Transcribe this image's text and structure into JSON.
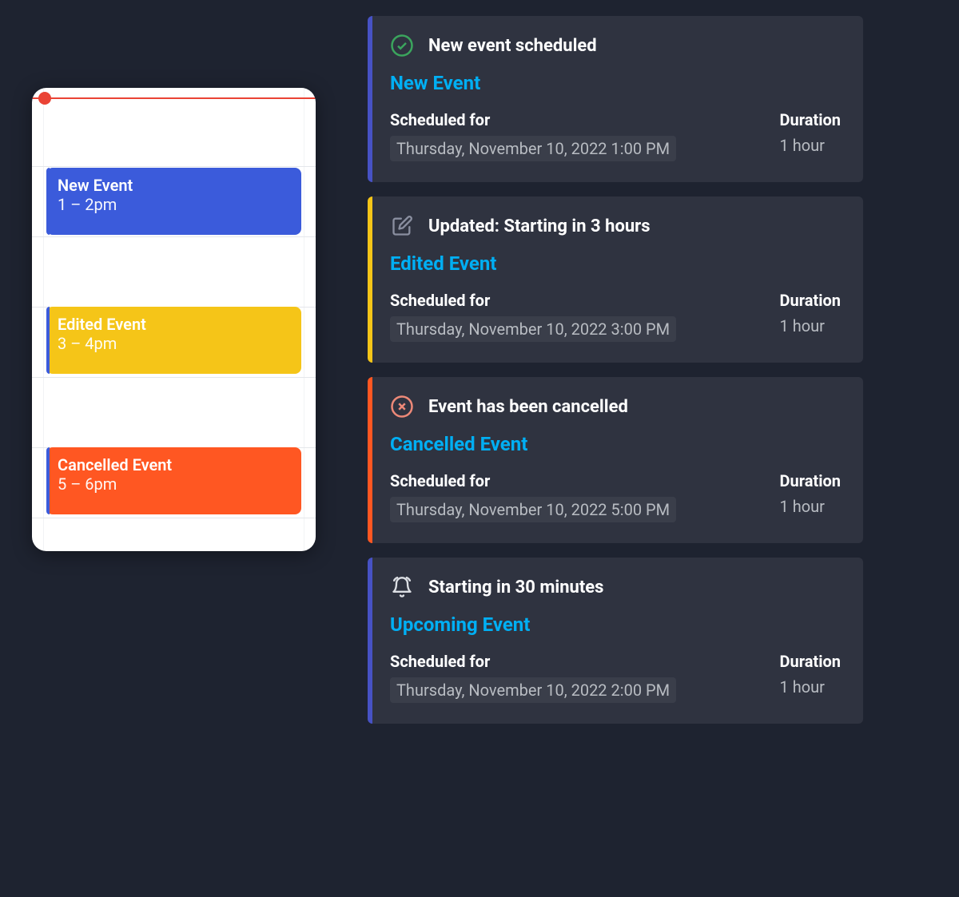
{
  "calendar": {
    "events": [
      {
        "title": "New Event",
        "time": "1 – 2pm"
      },
      {
        "title": "Edited Event",
        "time": "3 – 4pm"
      },
      {
        "title": "Cancelled Event",
        "time": "5 – 6pm"
      }
    ]
  },
  "labels": {
    "scheduled_for": "Scheduled for",
    "duration": "Duration"
  },
  "cards": [
    {
      "header": "New event scheduled",
      "title": "New Event",
      "scheduled": "Thursday, November 10, 2022 1:00 PM",
      "duration": "1 hour"
    },
    {
      "header": "Updated: Starting in 3 hours",
      "title": "Edited Event",
      "scheduled": "Thursday, November 10, 2022 3:00 PM",
      "duration": "1 hour"
    },
    {
      "header": "Event has been cancelled",
      "title": "Cancelled Event",
      "scheduled": "Thursday, November 10, 2022 5:00 PM",
      "duration": "1 hour"
    },
    {
      "header": "Starting in 30 minutes",
      "title": "Upcoming Event",
      "scheduled": "Thursday, November 10, 2022 2:00 PM",
      "duration": "1 hour"
    }
  ]
}
